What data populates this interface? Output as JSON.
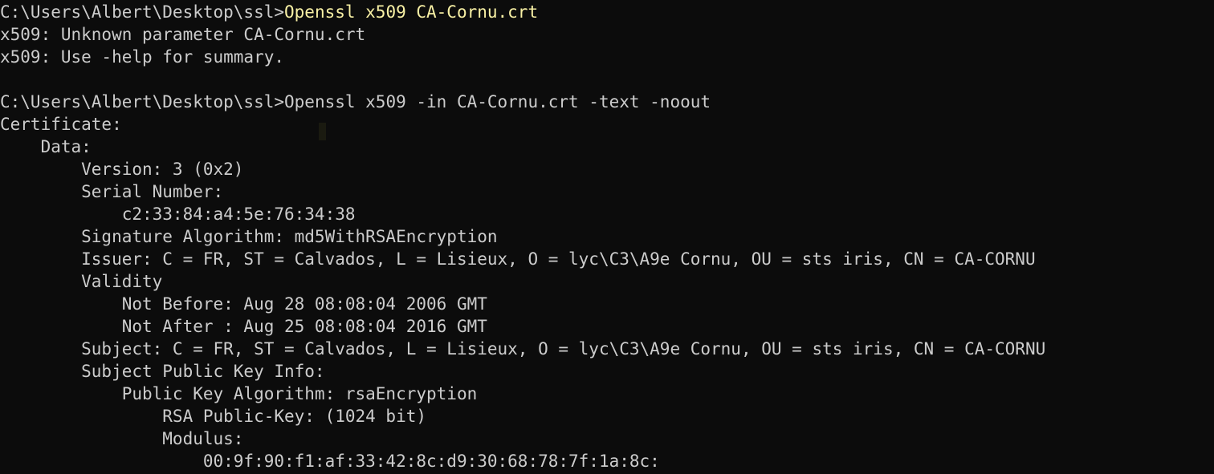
{
  "terminal": {
    "lines": [
      {
        "prompt": "C:\\Users\\Albert\\Desktop\\ssl>",
        "command": "Openssl x509 CA-Cornu.crt",
        "highlight": true
      },
      {
        "text": "x509: Unknown parameter CA-Cornu.crt"
      },
      {
        "text": "x509: Use -help for summary."
      },
      {
        "text": ""
      },
      {
        "prompt": "C:\\Users\\Albert\\Desktop\\ssl>",
        "command": "Openssl x509 -in CA-Cornu.crt -text -noout",
        "highlight": false
      },
      {
        "text": "Certificate:"
      },
      {
        "text": "    Data:"
      },
      {
        "text": "        Version: 3 (0x2)"
      },
      {
        "text": "        Serial Number:"
      },
      {
        "text": "            c2:33:84:a4:5e:76:34:38"
      },
      {
        "text": "        Signature Algorithm: md5WithRSAEncryption"
      },
      {
        "text": "        Issuer: C = FR, ST = Calvados, L = Lisieux, O = lyc\\C3\\A9e Cornu, OU = sts iris, CN = CA-CORNU"
      },
      {
        "text": "        Validity"
      },
      {
        "text": "            Not Before: Aug 28 08:08:04 2006 GMT"
      },
      {
        "text": "            Not After : Aug 25 08:08:04 2016 GMT"
      },
      {
        "text": "        Subject: C = FR, ST = Calvados, L = Lisieux, O = lyc\\C3\\A9e Cornu, OU = sts iris, CN = CA-CORNU"
      },
      {
        "text": "        Subject Public Key Info:"
      },
      {
        "text": "            Public Key Algorithm: rsaEncryption"
      },
      {
        "text": "                RSA Public-Key: (1024 bit)"
      },
      {
        "text": "                Modulus:"
      },
      {
        "text": "                    00:9f:90:f1:af:33:42:8c:d9:30:68:78:7f:1a:8c:"
      }
    ]
  },
  "colors": {
    "background": "#0c0c0c",
    "foreground": "#cccccc",
    "highlight_command": "#f9f1a5"
  }
}
